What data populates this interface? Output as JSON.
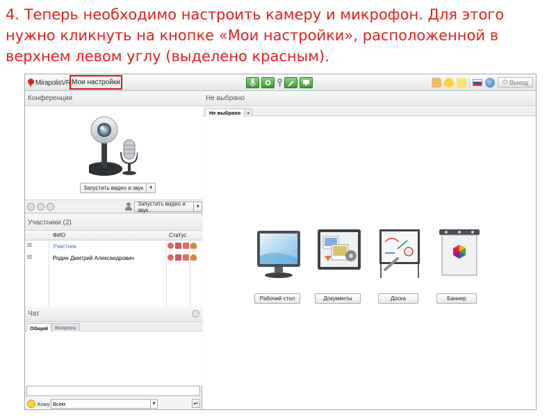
{
  "caption": "4. Теперь необходимо настроить камеру и микрофон. Для этого нужно кликнуть на кнопке «Мои настройки», расположенной в верхнем левом углу (выделено красным).",
  "topbar": {
    "logo_text": "MirapolisVR",
    "settings_label": "Мои настройки",
    "exit_label": "Выход",
    "media_buttons": [
      "microphone-icon",
      "camera-icon",
      "key-icon",
      "pencil-icon",
      "screen-icon"
    ],
    "right_icons": [
      "hand-icon",
      "smile-icon",
      "note-icon",
      "russia-flag-icon",
      "globe-icon"
    ]
  },
  "conference": {
    "title": "Конференция",
    "start_label": "Запустить видео и звук",
    "start_label_toolbar": "Запустить видео и звук"
  },
  "participants": {
    "title": "Участники (2)",
    "columns": [
      "ФИО",
      "Статус"
    ],
    "rows": [
      {
        "name": "Участник"
      },
      {
        "name": "Родин Дмитрий Александрович"
      }
    ]
  },
  "chat": {
    "title": "Чат",
    "tabs": [
      "Общий",
      "Вопросы"
    ],
    "to_label": "Кому",
    "to_value": "Всем"
  },
  "workspace": {
    "title": "Не выбрано",
    "tabs": [
      "Не выбрано",
      "+"
    ],
    "tools": [
      "Рабочий стол",
      "Документы",
      "Доска",
      "Баннер"
    ]
  },
  "colors": {
    "caption": "#e02020",
    "highlight": "#e4100f",
    "accent_green": "#3e9a36"
  }
}
